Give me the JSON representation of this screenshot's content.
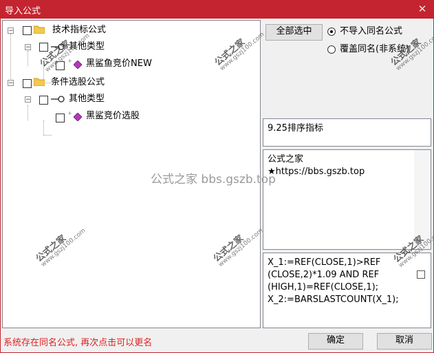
{
  "window": {
    "title": "导入公式",
    "close_glyph": "✕"
  },
  "tree": {
    "nodes": [
      {
        "label": "技术指标公式",
        "expander": "−"
      },
      {
        "label": "其他类型",
        "expander": "−"
      },
      {
        "label": "黑鲨鱼竞价NEW"
      },
      {
        "label": "条件选股公式",
        "expander": "−"
      },
      {
        "label": "其他类型",
        "expander": "−"
      },
      {
        "label": "黑鲨竞价选股"
      }
    ]
  },
  "options": {
    "select_all": "全部选中",
    "radio_skip": "不导入同名公式",
    "radio_overwrite": "覆盖同名(非系统)",
    "selected": "skip"
  },
  "panels": {
    "name": "9.25排序指标",
    "description": "公式之家\n★https://bbs.gszb.top",
    "code": "X_1:=REF(CLOSE,1)>REF\n(CLOSE,2)*1.09 AND REF\n(HIGH,1)=REF(CLOSE,1);\nX_2:=BARSLASTCOUNT(X_1);"
  },
  "status_text": "系统存在同名公式, 再次点击可以更名",
  "buttons": {
    "ok": "确定",
    "cancel": "取消"
  },
  "watermarks": {
    "brand": "公式之家",
    "site": "www.gszj100.com",
    "center": "公式之家 bbs.gszb.top"
  },
  "colors": {
    "titlebar": "#c4242f",
    "status": "#e02020",
    "folder": "#f2c94c",
    "formula_icon": "#b03ab8"
  }
}
